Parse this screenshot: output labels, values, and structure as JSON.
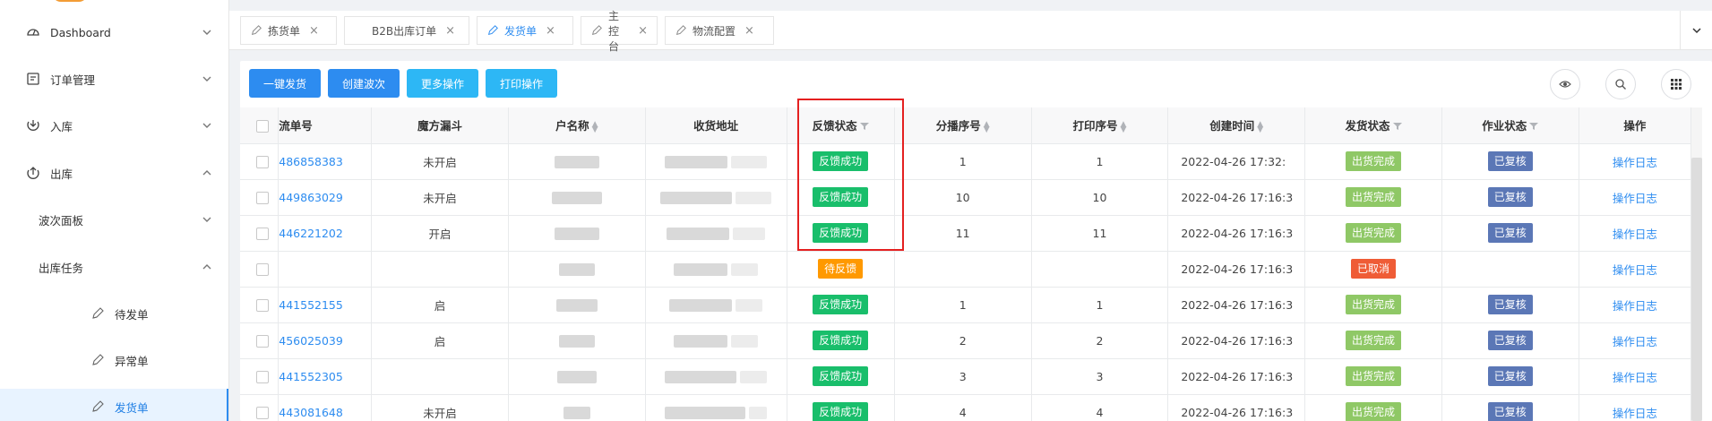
{
  "sidebar": {
    "items": [
      {
        "label": "Dashboard",
        "icon": "dashboard-icon",
        "caret": "down"
      },
      {
        "label": "订单管理",
        "icon": "order-icon",
        "caret": "down"
      },
      {
        "label": "入库",
        "icon": "inbound-icon",
        "caret": "down"
      },
      {
        "label": "出库",
        "icon": "outbound-icon",
        "caret": "up"
      },
      {
        "label": "波次面板",
        "caret": "down"
      },
      {
        "label": "出库任务",
        "caret": "up"
      },
      {
        "label": "待发单",
        "icon": "pen-icon"
      },
      {
        "label": "异常单",
        "icon": "pen-icon"
      },
      {
        "label": "发货单",
        "icon": "pen-icon",
        "active": true
      }
    ]
  },
  "tabs": [
    {
      "label": "拣货单",
      "close": "×"
    },
    {
      "label": "B2B出库订单",
      "close": "×"
    },
    {
      "label": "发货单",
      "close": "×",
      "active": true
    },
    {
      "label": "主控台",
      "close": "×"
    },
    {
      "label": "物流配置",
      "close": "×"
    }
  ],
  "toolbar": {
    "buttons": [
      "一键发货",
      "创建波次",
      "更多操作",
      "打印操作"
    ]
  },
  "table": {
    "headers": [
      "流单号",
      "魔方漏斗",
      "户名称",
      "收货地址",
      "反馈状态",
      "分播序号",
      "打印序号",
      "创建时间",
      "发货状态",
      "作业状态",
      "操作"
    ],
    "rows": [
      {
        "no": "486858383",
        "funnel": "未开启",
        "feedback": "反馈成功",
        "feedback_color": "green",
        "seq": "1",
        "print": "1",
        "time": "2022-04-26 17:32:",
        "ship": "出货完成",
        "work": "已复核",
        "op": "操作日志"
      },
      {
        "no": "449863029",
        "funnel": "未开启",
        "feedback": "反馈成功",
        "feedback_color": "green",
        "seq": "10",
        "print": "10",
        "time": "2022-04-26 17:16:3",
        "ship": "出货完成",
        "work": "已复核",
        "op": "操作日志"
      },
      {
        "no": "446221202",
        "funnel": "开启",
        "feedback": "反馈成功",
        "feedback_color": "green",
        "seq": "11",
        "print": "11",
        "time": "2022-04-26 17:16:3",
        "ship": "出货完成",
        "work": "已复核",
        "op": "操作日志"
      },
      {
        "no": "",
        "funnel": "",
        "feedback": "待反馈",
        "feedback_color": "orange",
        "seq": "",
        "print": "",
        "time": "2022-04-26 17:16:3",
        "ship": "已取消",
        "ship_color": "red",
        "work": "",
        "op": "操作日志"
      },
      {
        "no": "441552155",
        "funnel": "启",
        "feedback": "反馈成功",
        "feedback_color": "green",
        "seq": "1",
        "print": "1",
        "time": "2022-04-26 17:16:3",
        "ship": "出货完成",
        "work": "已复核",
        "op": "操作日志"
      },
      {
        "no": "456025039",
        "funnel": "启",
        "feedback": "反馈成功",
        "feedback_color": "green",
        "seq": "2",
        "print": "2",
        "time": "2022-04-26 17:16:3",
        "ship": "出货完成",
        "work": "已复核",
        "op": "操作日志"
      },
      {
        "no": "441552305",
        "funnel": "",
        "feedback": "反馈成功",
        "feedback_color": "green",
        "seq": "3",
        "print": "3",
        "time": "2022-04-26 17:16:3",
        "ship": "出货完成",
        "work": "已复核",
        "op": "操作日志"
      },
      {
        "no": "443081648",
        "funnel": "未开启",
        "feedback": "反馈成功",
        "feedback_color": "green",
        "seq": "4",
        "print": "4",
        "time": "2022-04-26 17:16:3",
        "ship": "出货完成",
        "work": "已复核",
        "op": "操作日志"
      }
    ]
  },
  "colors": {
    "primary": "#2d8cf0",
    "cyan": "#2db7f5",
    "success": "#19be6b",
    "warning": "#ff9900",
    "highlight_box": "#e42020"
  }
}
